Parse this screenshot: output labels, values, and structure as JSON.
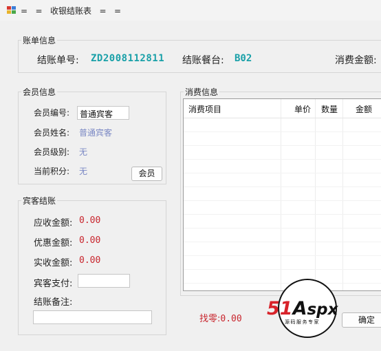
{
  "window": {
    "title": "=   =   收银结账表   =   ="
  },
  "bill_info": {
    "legend": "账单信息",
    "bill_no_label": "结账单号:",
    "bill_no": "ZD2008112811",
    "table_label": "结账餐台:",
    "table_no": "B02",
    "amount_label": "消费金额:"
  },
  "member_info": {
    "legend": "会员信息",
    "id_label": "会员编号:",
    "id_value": "普通宾客",
    "name_label": "会员姓名:",
    "name_value": "普通宾客",
    "level_label": "会员级别:",
    "level_value": "无",
    "points_label": "当前积分:",
    "points_value": "无",
    "member_button": "会员"
  },
  "checkout": {
    "legend": "宾客结账",
    "receivable_label": "应收金额:",
    "receivable_value": "0.00",
    "discount_label": "优惠金额:",
    "discount_value": "0.00",
    "actual_label": "实收金额:",
    "actual_value": "0.00",
    "paid_label": "宾客支付:",
    "paid_value": "",
    "note_label": "结账备注:",
    "note_value": ""
  },
  "consumption": {
    "legend": "消费信息",
    "columns": [
      "消费项目",
      "单价",
      "数量",
      "金额"
    ],
    "rows": []
  },
  "change": {
    "label": "找零:",
    "value": "0.00"
  },
  "confirm_button": "确定",
  "watermark": {
    "brand": "51Aspx",
    "tagline": "源码服务专家"
  },
  "colors": {
    "accent_teal": "#19a0a8",
    "value_red": "#c8242c",
    "value_blue": "#7a88c4",
    "logo_red": "#d8232a"
  }
}
